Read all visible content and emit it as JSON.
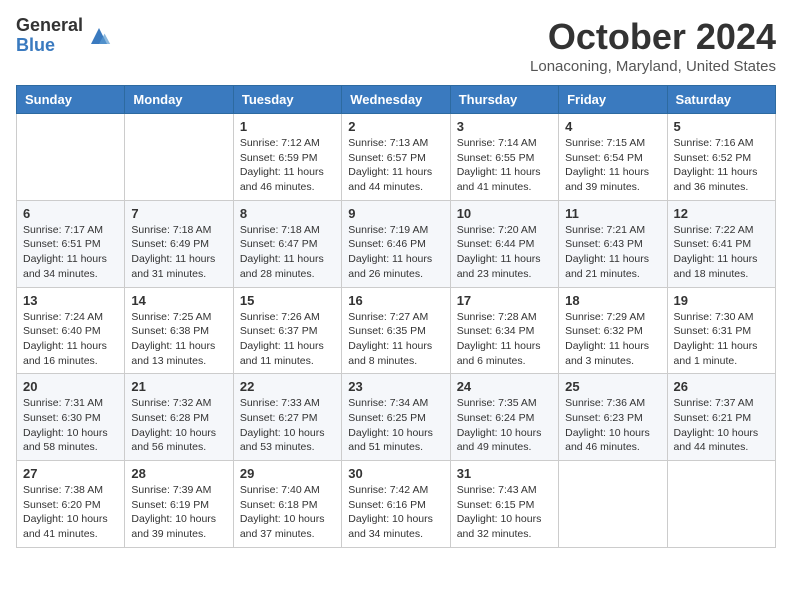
{
  "header": {
    "logo_general": "General",
    "logo_blue": "Blue",
    "month": "October 2024",
    "location": "Lonaconing, Maryland, United States"
  },
  "days_of_week": [
    "Sunday",
    "Monday",
    "Tuesday",
    "Wednesday",
    "Thursday",
    "Friday",
    "Saturday"
  ],
  "weeks": [
    [
      {
        "day": "",
        "text": ""
      },
      {
        "day": "",
        "text": ""
      },
      {
        "day": "1",
        "text": "Sunrise: 7:12 AM\nSunset: 6:59 PM\nDaylight: 11 hours and 46 minutes."
      },
      {
        "day": "2",
        "text": "Sunrise: 7:13 AM\nSunset: 6:57 PM\nDaylight: 11 hours and 44 minutes."
      },
      {
        "day": "3",
        "text": "Sunrise: 7:14 AM\nSunset: 6:55 PM\nDaylight: 11 hours and 41 minutes."
      },
      {
        "day": "4",
        "text": "Sunrise: 7:15 AM\nSunset: 6:54 PM\nDaylight: 11 hours and 39 minutes."
      },
      {
        "day": "5",
        "text": "Sunrise: 7:16 AM\nSunset: 6:52 PM\nDaylight: 11 hours and 36 minutes."
      }
    ],
    [
      {
        "day": "6",
        "text": "Sunrise: 7:17 AM\nSunset: 6:51 PM\nDaylight: 11 hours and 34 minutes."
      },
      {
        "day": "7",
        "text": "Sunrise: 7:18 AM\nSunset: 6:49 PM\nDaylight: 11 hours and 31 minutes."
      },
      {
        "day": "8",
        "text": "Sunrise: 7:18 AM\nSunset: 6:47 PM\nDaylight: 11 hours and 28 minutes."
      },
      {
        "day": "9",
        "text": "Sunrise: 7:19 AM\nSunset: 6:46 PM\nDaylight: 11 hours and 26 minutes."
      },
      {
        "day": "10",
        "text": "Sunrise: 7:20 AM\nSunset: 6:44 PM\nDaylight: 11 hours and 23 minutes."
      },
      {
        "day": "11",
        "text": "Sunrise: 7:21 AM\nSunset: 6:43 PM\nDaylight: 11 hours and 21 minutes."
      },
      {
        "day": "12",
        "text": "Sunrise: 7:22 AM\nSunset: 6:41 PM\nDaylight: 11 hours and 18 minutes."
      }
    ],
    [
      {
        "day": "13",
        "text": "Sunrise: 7:24 AM\nSunset: 6:40 PM\nDaylight: 11 hours and 16 minutes."
      },
      {
        "day": "14",
        "text": "Sunrise: 7:25 AM\nSunset: 6:38 PM\nDaylight: 11 hours and 13 minutes."
      },
      {
        "day": "15",
        "text": "Sunrise: 7:26 AM\nSunset: 6:37 PM\nDaylight: 11 hours and 11 minutes."
      },
      {
        "day": "16",
        "text": "Sunrise: 7:27 AM\nSunset: 6:35 PM\nDaylight: 11 hours and 8 minutes."
      },
      {
        "day": "17",
        "text": "Sunrise: 7:28 AM\nSunset: 6:34 PM\nDaylight: 11 hours and 6 minutes."
      },
      {
        "day": "18",
        "text": "Sunrise: 7:29 AM\nSunset: 6:32 PM\nDaylight: 11 hours and 3 minutes."
      },
      {
        "day": "19",
        "text": "Sunrise: 7:30 AM\nSunset: 6:31 PM\nDaylight: 11 hours and 1 minute."
      }
    ],
    [
      {
        "day": "20",
        "text": "Sunrise: 7:31 AM\nSunset: 6:30 PM\nDaylight: 10 hours and 58 minutes."
      },
      {
        "day": "21",
        "text": "Sunrise: 7:32 AM\nSunset: 6:28 PM\nDaylight: 10 hours and 56 minutes."
      },
      {
        "day": "22",
        "text": "Sunrise: 7:33 AM\nSunset: 6:27 PM\nDaylight: 10 hours and 53 minutes."
      },
      {
        "day": "23",
        "text": "Sunrise: 7:34 AM\nSunset: 6:25 PM\nDaylight: 10 hours and 51 minutes."
      },
      {
        "day": "24",
        "text": "Sunrise: 7:35 AM\nSunset: 6:24 PM\nDaylight: 10 hours and 49 minutes."
      },
      {
        "day": "25",
        "text": "Sunrise: 7:36 AM\nSunset: 6:23 PM\nDaylight: 10 hours and 46 minutes."
      },
      {
        "day": "26",
        "text": "Sunrise: 7:37 AM\nSunset: 6:21 PM\nDaylight: 10 hours and 44 minutes."
      }
    ],
    [
      {
        "day": "27",
        "text": "Sunrise: 7:38 AM\nSunset: 6:20 PM\nDaylight: 10 hours and 41 minutes."
      },
      {
        "day": "28",
        "text": "Sunrise: 7:39 AM\nSunset: 6:19 PM\nDaylight: 10 hours and 39 minutes."
      },
      {
        "day": "29",
        "text": "Sunrise: 7:40 AM\nSunset: 6:18 PM\nDaylight: 10 hours and 37 minutes."
      },
      {
        "day": "30",
        "text": "Sunrise: 7:42 AM\nSunset: 6:16 PM\nDaylight: 10 hours and 34 minutes."
      },
      {
        "day": "31",
        "text": "Sunrise: 7:43 AM\nSunset: 6:15 PM\nDaylight: 10 hours and 32 minutes."
      },
      {
        "day": "",
        "text": ""
      },
      {
        "day": "",
        "text": ""
      }
    ]
  ]
}
